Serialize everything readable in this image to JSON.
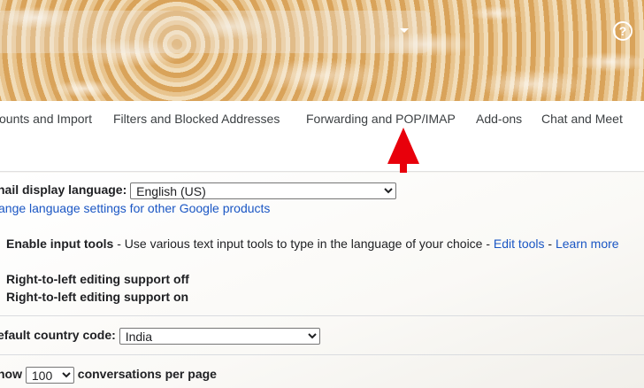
{
  "header": {
    "help_icon_glyph": "?"
  },
  "tabs": [
    {
      "label": "ounts and Import"
    },
    {
      "label": "Filters and Blocked Addresses"
    },
    {
      "label": "Forwarding and POP/IMAP"
    },
    {
      "label": "Add-ons"
    },
    {
      "label": "Chat and Meet"
    }
  ],
  "settings": {
    "display_language_label": "nail display language:",
    "display_language_value": "English (US)",
    "change_language_link": "ange language settings for other Google products",
    "input_tools_label": "Enable input tools",
    "input_tools_desc": " - Use various text input tools to type in the language of your choice - ",
    "edit_tools_link": "Edit tools",
    "sep": " - ",
    "learn_more_link": "Learn more",
    "rtl_off": "Right-to-left editing support off",
    "rtl_on": "Right-to-left editing support on",
    "country_code_label": "efault country code:",
    "country_code_value": "India",
    "page_size_prefix": "now",
    "page_size_value": "100",
    "page_size_suffix": "conversations per page"
  },
  "annotation": {
    "arrow_color": "#e8000b"
  }
}
